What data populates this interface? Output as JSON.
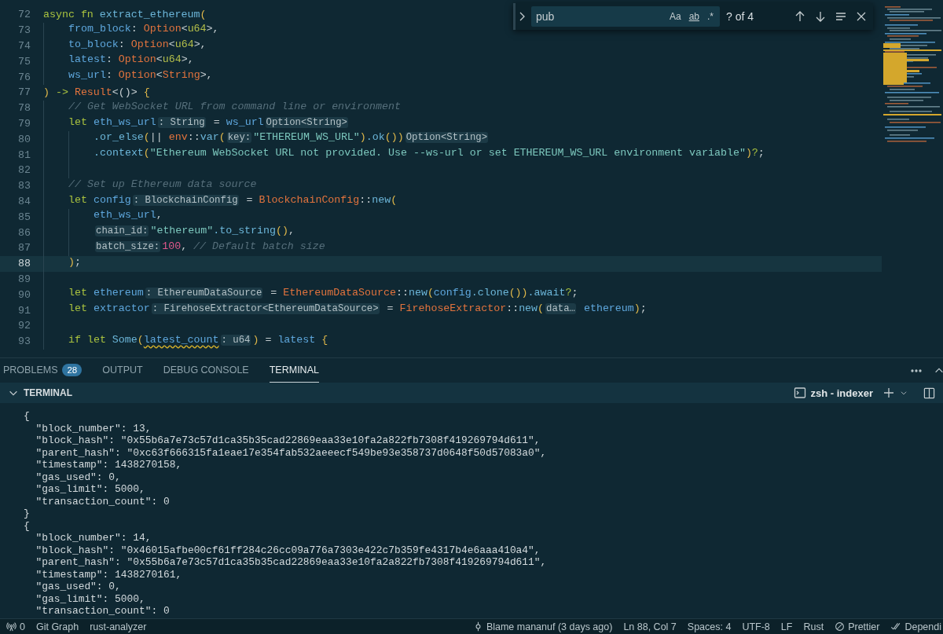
{
  "editor": {
    "lines": [
      {
        "number": "72",
        "current": false,
        "tokens": [
          {
            "kind": "kw",
            "text": "async fn "
          },
          {
            "kind": "fn",
            "text": "extract_ethereum"
          },
          {
            "kind": "br",
            "text": "("
          }
        ],
        "children": [
          {
            "number": "73",
            "current": false,
            "tokens": [
              {
                "kind": "var",
                "text": "from_block"
              },
              {
                "kind": "p",
                "text": ": "
              },
              {
                "kind": "type",
                "text": "Option"
              },
              {
                "kind": "p",
                "text": "<"
              },
              {
                "kind": "tp",
                "text": "u64"
              },
              {
                "kind": "p",
                "text": ">,"
              }
            ]
          },
          {
            "number": "74",
            "current": false,
            "tokens": [
              {
                "kind": "var",
                "text": "to_block"
              },
              {
                "kind": "p",
                "text": ": "
              },
              {
                "kind": "type",
                "text": "Option"
              },
              {
                "kind": "p",
                "text": "<"
              },
              {
                "kind": "tp",
                "text": "u64"
              },
              {
                "kind": "p",
                "text": ">,"
              }
            ]
          },
          {
            "number": "75",
            "current": false,
            "tokens": [
              {
                "kind": "var",
                "text": "latest"
              },
              {
                "kind": "p",
                "text": ": "
              },
              {
                "kind": "type",
                "text": "Option"
              },
              {
                "kind": "p",
                "text": "<"
              },
              {
                "kind": "tp",
                "text": "u64"
              },
              {
                "kind": "p",
                "text": ">,"
              }
            ]
          },
          {
            "number": "76",
            "current": false,
            "tokens": [
              {
                "kind": "var",
                "text": "ws_url"
              },
              {
                "kind": "p",
                "text": ": "
              },
              {
                "kind": "type",
                "text": "Option"
              },
              {
                "kind": "p",
                "text": "<"
              },
              {
                "kind": "type",
                "text": "String"
              },
              {
                "kind": "p",
                "text": ">,"
              }
            ]
          }
        ]
      },
      {
        "number": "77",
        "current": false,
        "tokens": [
          {
            "kind": "br",
            "text": ")"
          },
          {
            "kind": "kw",
            "text": " -> "
          },
          {
            "kind": "type",
            "text": "Result"
          },
          {
            "kind": "p",
            "text": "<()> "
          },
          {
            "kind": "br",
            "text": "{"
          }
        ],
        "children": [
          {
            "number": "78",
            "current": false,
            "tokens": [
              {
                "kind": "comment",
                "text": "// Get WebSocket URL from command line or environment"
              }
            ]
          },
          {
            "number": "79",
            "current": false,
            "tokens": [
              {
                "kind": "kw",
                "text": "let "
              },
              {
                "kind": "var",
                "text": "eth_ws_url"
              },
              {
                "kind": "hint",
                "text": ": String"
              },
              {
                "kind": "p",
                "text": " = "
              },
              {
                "kind": "var",
                "text": "ws_url"
              },
              {
                "kind": "hint",
                "text": "Option<String>"
              }
            ],
            "children": [
              {
                "number": "80",
                "current": false,
                "tokens": [
                  {
                    "kind": "fn",
                    "text": ".or_else"
                  },
                  {
                    "kind": "br",
                    "text": "("
                  },
                  {
                    "kind": "p",
                    "text": "|| "
                  },
                  {
                    "kind": "type",
                    "text": "env"
                  },
                  {
                    "kind": "p",
                    "text": "::"
                  },
                  {
                    "kind": "fn",
                    "text": "var"
                  },
                  {
                    "kind": "br",
                    "text": "("
                  },
                  {
                    "kind": "hint",
                    "text": "key:"
                  },
                  {
                    "kind": "str",
                    "text": "\"ETHEREUM_WS_URL\""
                  },
                  {
                    "kind": "br",
                    "text": ")"
                  },
                  {
                    "kind": "fn",
                    "text": ".ok"
                  },
                  {
                    "kind": "br",
                    "text": "())"
                  },
                  {
                    "kind": "hint",
                    "text": "Option<String>"
                  }
                ]
              },
              {
                "number": "81",
                "current": false,
                "tokens": [
                  {
                    "kind": "fn",
                    "text": ".context"
                  },
                  {
                    "kind": "br",
                    "text": "("
                  },
                  {
                    "kind": "str",
                    "text": "\"Ethereum WebSocket URL not provided. Use --ws-url or set ETHEREUM_WS_URL environment variable\""
                  },
                  {
                    "kind": "br",
                    "text": ")"
                  },
                  {
                    "kind": "kw",
                    "text": "?"
                  },
                  {
                    "kind": "p",
                    "text": ";"
                  }
                ]
              },
              {
                "number": "82",
                "current": false
              }
            ]
          },
          {
            "number": "83",
            "current": false,
            "tokens": [
              {
                "kind": "comment",
                "text": "// Set up Ethereum data source"
              }
            ]
          },
          {
            "number": "84",
            "current": false,
            "tokens": [
              {
                "kind": "kw",
                "text": "let "
              },
              {
                "kind": "var",
                "text": "config"
              },
              {
                "kind": "hint",
                "text": ": BlockchainConfig"
              },
              {
                "kind": "p",
                "text": " = "
              },
              {
                "kind": "type",
                "text": "BlockchainConfig"
              },
              {
                "kind": "p",
                "text": "::"
              },
              {
                "kind": "fn",
                "text": "new"
              },
              {
                "kind": "br",
                "text": "("
              }
            ],
            "children": [
              {
                "number": "85",
                "current": false,
                "tokens": [
                  {
                    "kind": "var",
                    "text": "eth_ws_url"
                  },
                  {
                    "kind": "p",
                    "text": ","
                  }
                ]
              },
              {
                "number": "86",
                "current": false,
                "tokens": [
                  {
                    "kind": "hint",
                    "text": "chain_id:"
                  },
                  {
                    "kind": "str",
                    "text": "\"ethereum\""
                  },
                  {
                    "kind": "fn",
                    "text": ".to_string"
                  },
                  {
                    "kind": "br",
                    "text": "()"
                  },
                  {
                    "kind": "p",
                    "text": ","
                  }
                ]
              },
              {
                "number": "87",
                "current": false,
                "tokens": [
                  {
                    "kind": "hint",
                    "text": "batch_size:"
                  },
                  {
                    "kind": "num",
                    "text": "100"
                  },
                  {
                    "kind": "p",
                    "text": ", "
                  },
                  {
                    "kind": "comment",
                    "text": "// Default batch size"
                  }
                ]
              }
            ]
          },
          {
            "number": "88",
            "current": true,
            "tokens": [
              {
                "kind": "br",
                "text": ")"
              },
              {
                "kind": "p",
                "text": ";"
              }
            ]
          },
          {
            "number": "89",
            "current": false
          },
          {
            "number": "90",
            "current": false,
            "tokens": [
              {
                "kind": "kw",
                "text": "let "
              },
              {
                "kind": "var",
                "text": "ethereum"
              },
              {
                "kind": "hint",
                "text": ": EthereumDataSource"
              },
              {
                "kind": "p",
                "text": " = "
              },
              {
                "kind": "type",
                "text": "EthereumDataSource"
              },
              {
                "kind": "p",
                "text": "::"
              },
              {
                "kind": "fn",
                "text": "new"
              },
              {
                "kind": "br",
                "text": "("
              },
              {
                "kind": "var",
                "text": "config"
              },
              {
                "kind": "fn",
                "text": ".clone"
              },
              {
                "kind": "br",
                "text": "())"
              },
              {
                "kind": "fn",
                "text": ".await"
              },
              {
                "kind": "kw",
                "text": "?"
              },
              {
                "kind": "p",
                "text": ";"
              }
            ]
          },
          {
            "number": "91",
            "current": false,
            "tokens": [
              {
                "kind": "kw",
                "text": "let "
              },
              {
                "kind": "var",
                "text": "extractor"
              },
              {
                "kind": "hint",
                "text": ": FirehoseExtractor<EthereumDataSource>"
              },
              {
                "kind": "p",
                "text": " = "
              },
              {
                "kind": "type",
                "text": "FirehoseExtractor"
              },
              {
                "kind": "p",
                "text": "::"
              },
              {
                "kind": "fn",
                "text": "new"
              },
              {
                "kind": "br",
                "text": "("
              },
              {
                "kind": "hint",
                "text": "data…"
              },
              {
                "kind": "var",
                "text": " ethereum"
              },
              {
                "kind": "br",
                "text": ")"
              },
              {
                "kind": "p",
                "text": ";"
              }
            ]
          },
          {
            "number": "92",
            "current": false
          },
          {
            "number": "93",
            "current": false,
            "tokens": [
              {
                "kind": "kw",
                "text": "if let "
              },
              {
                "kind": "fn",
                "text": "Some"
              },
              {
                "kind": "br",
                "text": "("
              },
              {
                "kind": "warn",
                "text": "latest_count"
              },
              {
                "kind": "hint",
                "text": ": u64"
              },
              {
                "kind": "br",
                "text": ")"
              },
              {
                "kind": "p",
                "text": " = "
              },
              {
                "kind": "var",
                "text": "latest "
              },
              {
                "kind": "br",
                "text": "{"
              }
            ]
          }
        ]
      }
    ]
  },
  "find_widget": {
    "value": "pub",
    "options": [
      {
        "label": "Aa",
        "on": false
      },
      {
        "label": "ab",
        "on": false
      },
      {
        "label": ".*",
        "on": false
      }
    ],
    "match_count": "? of 4"
  },
  "panel": {
    "tabs": [
      {
        "label": "PROBLEMS",
        "badge": "28",
        "selected": false
      },
      {
        "label": "OUTPUT",
        "selected": false
      },
      {
        "label": "DEBUG CONSOLE",
        "selected": false
      },
      {
        "label": "TERMINAL",
        "selected": true
      }
    ],
    "section_title": "TERMINAL",
    "terminal_name": "zsh - indexer",
    "output": [
      {
        "open": "{",
        "fields": [
          "\"block_number\": 13,",
          "\"block_hash\": \"0x55b6a7e73c57d1ca35b35cad22869eaa33e10fa2a822fb7308f419269794d611\",",
          "\"parent_hash\": \"0xc63f666315fa1eae17e354fab532aeeecf549be93e358737d0648f50d57083a0\",",
          "\"timestamp\": 1438270158,",
          "\"gas_used\": 0,",
          "\"gas_limit\": 5000,",
          "\"transaction_count\": 0"
        ],
        "close": "}"
      },
      {
        "open": "{",
        "fields": [
          "\"block_number\": 14,",
          "\"block_hash\": \"0x46015afbe00cf61ff284c26cc09a776a7303e422c7b359fe4317b4e6aaa410a4\",",
          "\"parent_hash\": \"0x55b6a7e73c57d1ca35b35cad22869eaa33e10fa2a822fb7308f419269794d611\",",
          "\"timestamp\": 1438270161,",
          "\"gas_used\": 0,",
          "\"gas_limit\": 5000,",
          "\"transaction_count\": 0"
        ]
      }
    ]
  },
  "status_bar": {
    "left": [
      {
        "kind": "ports",
        "text": "0"
      },
      {
        "kind": "plain",
        "text": "Git Graph"
      },
      {
        "kind": "plain",
        "text": "rust-analyzer"
      }
    ],
    "right": [
      {
        "kind": "commit",
        "text": "Blame mananuf (3 days ago)"
      },
      {
        "kind": "plain",
        "text": "Ln 88, Col 7"
      },
      {
        "kind": "plain",
        "text": "Spaces: 4"
      },
      {
        "kind": "plain",
        "text": "UTF-8"
      },
      {
        "kind": "plain",
        "text": "LF"
      },
      {
        "kind": "plain",
        "text": "Rust"
      },
      {
        "kind": "prohibited",
        "text": "Prettier"
      },
      {
        "kind": "checks",
        "text": "Dependi"
      }
    ]
  }
}
